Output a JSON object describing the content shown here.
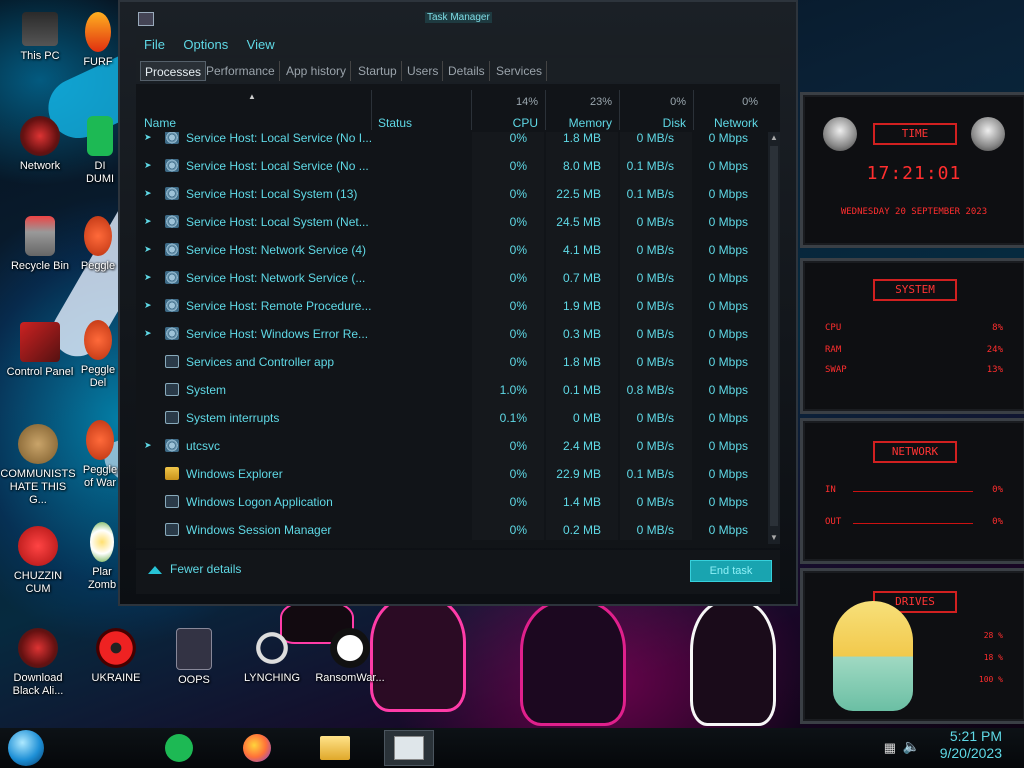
{
  "desktop": {
    "icons": [
      {
        "label": "This PC"
      },
      {
        "label": "Network"
      },
      {
        "label": "Recycle Bin"
      },
      {
        "label": "Control Panel"
      },
      {
        "label": "COMMUNISTS HATE THIS G..."
      },
      {
        "label": "CHUZZIN CUM"
      },
      {
        "label": "Download Black Ali..."
      },
      {
        "label": "FURF"
      },
      {
        "label": "DI DUMI"
      },
      {
        "label": "Peggle"
      },
      {
        "label": "Peggle Del"
      },
      {
        "label": "Peggle of War"
      },
      {
        "label": "Plar Zomb"
      },
      {
        "label": "UKRAINE"
      },
      {
        "label": "OOPS"
      },
      {
        "label": "LYNCHING"
      },
      {
        "label": "RansomWar..."
      }
    ]
  },
  "task_manager": {
    "title": "Task Manager",
    "menu": [
      "File",
      "Options",
      "View"
    ],
    "tabs": [
      "Processes",
      "Performance",
      "App history",
      "Startup",
      "Users",
      "Details",
      "Services"
    ],
    "active_tab": "Processes",
    "columns": {
      "name": "Name",
      "status": "Status",
      "cpu_pct": "14%",
      "cpu": "CPU",
      "mem_pct": "23%",
      "mem": "Memory",
      "disk_pct": "0%",
      "disk": "Disk",
      "net_pct": "0%",
      "net": "Network"
    },
    "rows": [
      {
        "name": "Service Host: Local Service (No I...",
        "cpu": "0%",
        "mem": "1.8 MB",
        "disk": "0 MB/s",
        "net": "0 Mbps",
        "icon": "gear",
        "expand": true
      },
      {
        "name": "Service Host: Local Service (No ...",
        "cpu": "0%",
        "mem": "8.0 MB",
        "disk": "0.1 MB/s",
        "net": "0 Mbps",
        "icon": "gear",
        "expand": true
      },
      {
        "name": "Service Host: Local System (13)",
        "cpu": "0%",
        "mem": "22.5 MB",
        "disk": "0.1 MB/s",
        "net": "0 Mbps",
        "icon": "gear",
        "expand": true
      },
      {
        "name": "Service Host: Local System (Net...",
        "cpu": "0%",
        "mem": "24.5 MB",
        "disk": "0 MB/s",
        "net": "0 Mbps",
        "icon": "gear",
        "expand": true
      },
      {
        "name": "Service Host: Network Service (4)",
        "cpu": "0%",
        "mem": "4.1 MB",
        "disk": "0 MB/s",
        "net": "0 Mbps",
        "icon": "gear",
        "expand": true
      },
      {
        "name": "Service Host: Network Service (...",
        "cpu": "0%",
        "mem": "0.7 MB",
        "disk": "0 MB/s",
        "net": "0 Mbps",
        "icon": "gear",
        "expand": true
      },
      {
        "name": "Service Host: Remote Procedure...",
        "cpu": "0%",
        "mem": "1.9 MB",
        "disk": "0 MB/s",
        "net": "0 Mbps",
        "icon": "gear",
        "expand": true
      },
      {
        "name": "Service Host: Windows Error Re...",
        "cpu": "0%",
        "mem": "0.3 MB",
        "disk": "0 MB/s",
        "net": "0 Mbps",
        "icon": "gear",
        "expand": true
      },
      {
        "name": "Services and Controller app",
        "cpu": "0%",
        "mem": "1.8 MB",
        "disk": "0 MB/s",
        "net": "0 Mbps",
        "icon": "win",
        "expand": false
      },
      {
        "name": "System",
        "cpu": "1.0%",
        "mem": "0.1 MB",
        "disk": "0.8 MB/s",
        "net": "0 Mbps",
        "icon": "win",
        "expand": false
      },
      {
        "name": "System interrupts",
        "cpu": "0.1%",
        "mem": "0 MB",
        "disk": "0 MB/s",
        "net": "0 Mbps",
        "icon": "win",
        "expand": false
      },
      {
        "name": "utcsvc",
        "cpu": "0%",
        "mem": "2.4 MB",
        "disk": "0 MB/s",
        "net": "0 Mbps",
        "icon": "gear",
        "expand": true
      },
      {
        "name": "Windows Explorer",
        "cpu": "0%",
        "mem": "22.9 MB",
        "disk": "0.1 MB/s",
        "net": "0 Mbps",
        "icon": "fold",
        "expand": false
      },
      {
        "name": "Windows Logon Application",
        "cpu": "0%",
        "mem": "1.4 MB",
        "disk": "0 MB/s",
        "net": "0 Mbps",
        "icon": "win",
        "expand": false
      },
      {
        "name": "Windows Session Manager",
        "cpu": "0%",
        "mem": "0.2 MB",
        "disk": "0 MB/s",
        "net": "0 Mbps",
        "icon": "win",
        "expand": false
      }
    ],
    "fewer_details": "Fewer details",
    "end_task": "End task"
  },
  "widget": {
    "time_title": "TIME",
    "time": "17:21:01",
    "date": "WEDNESDAY 20 SEPTEMBER 2023",
    "system_title": "SYSTEM",
    "cpu_label": "CPU",
    "cpu_val": "8%",
    "ram_label": "RAM",
    "ram_val": "24%",
    "swap_label": "SWAP",
    "swap_val": "13%",
    "network_title": "NETWORK",
    "in_label": "IN",
    "in_val": "0%",
    "out_label": "OUT",
    "out_val": "0%",
    "drives_title": "DRIVES",
    "drive1_val": "28 %",
    "drive2_val": "18 %",
    "drive3_val": "100 %"
  },
  "taskbar": {
    "apps": [
      "spotify-icon",
      "firefox-icon",
      "file-explorer-icon",
      "task-manager-icon"
    ],
    "time": "5:21 PM",
    "date": "9/20/2023"
  }
}
